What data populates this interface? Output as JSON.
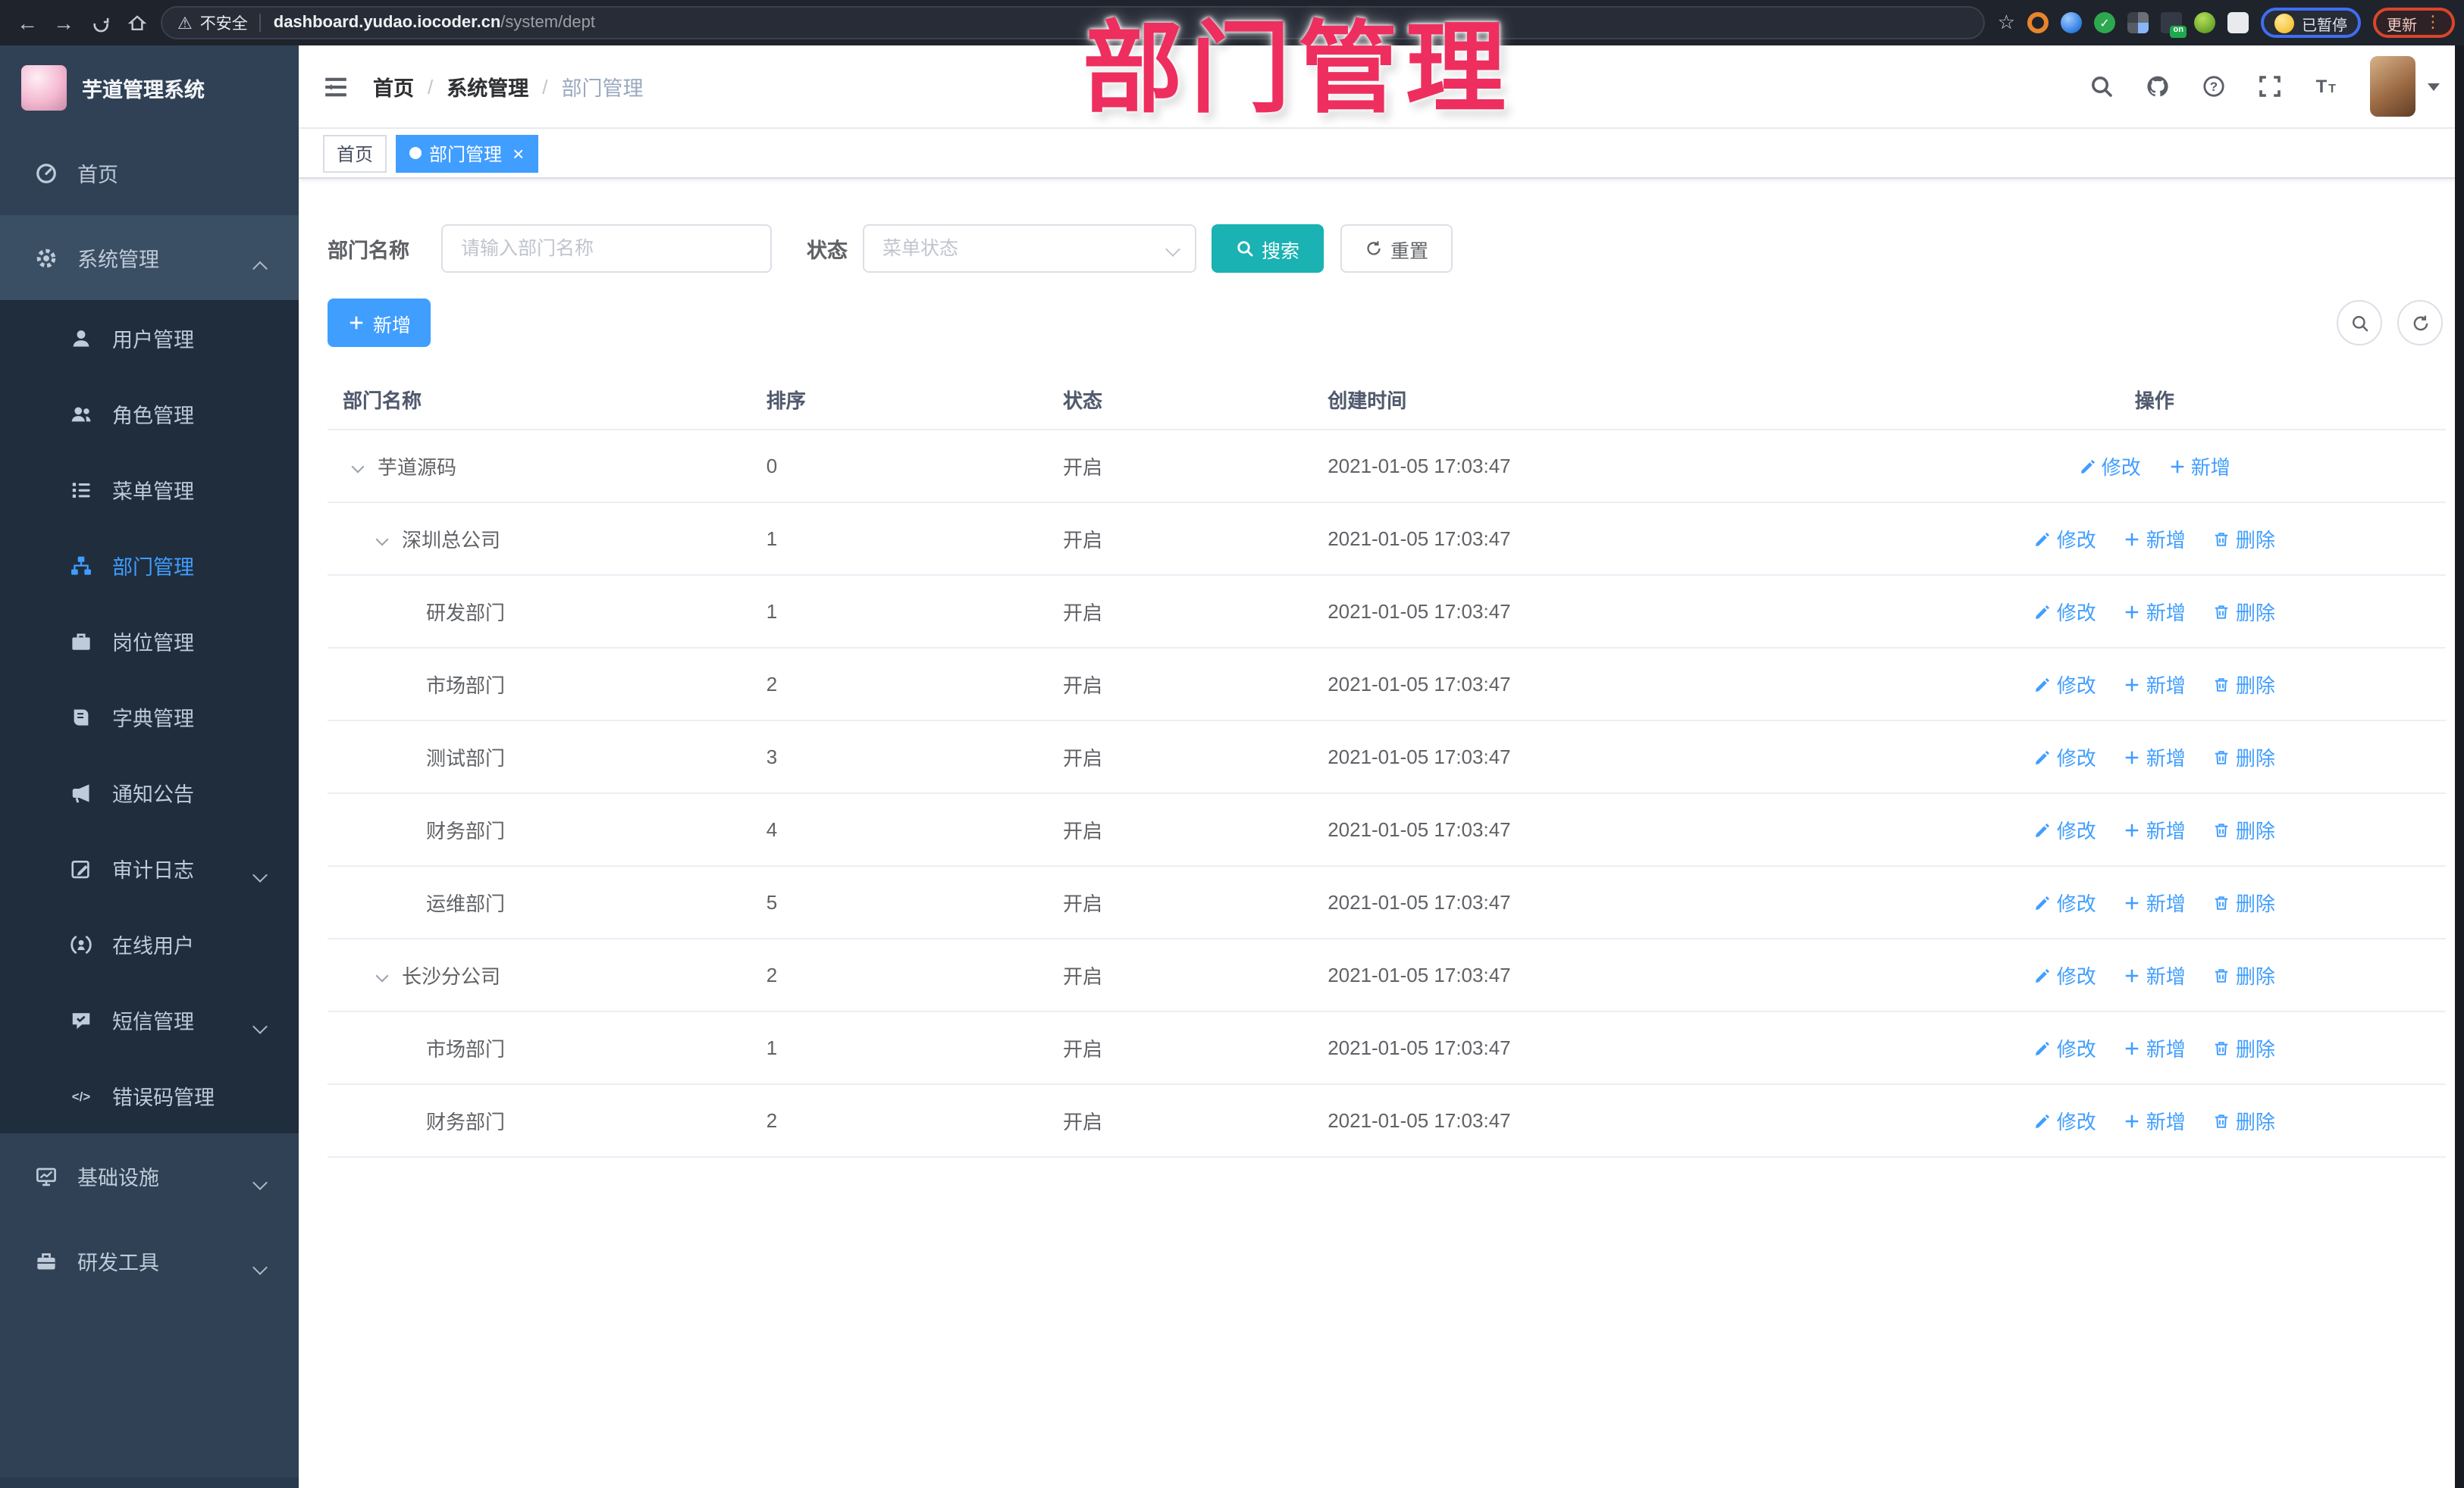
{
  "overlay_title": "部门管理",
  "browser": {
    "security_label": "不安全",
    "url_host": "dashboard.yudao.iocoder.cn",
    "url_path": "/system/dept",
    "paused_label": "已暂停",
    "update_label": "更新"
  },
  "app": {
    "title": "芋道管理系统"
  },
  "sidebar": {
    "items": [
      {
        "label": "首页",
        "icon": "dashboard-icon",
        "kind": "top"
      },
      {
        "label": "系统管理",
        "icon": "gear-icon",
        "kind": "top",
        "state": "open",
        "arrow": "up"
      },
      {
        "label": "用户管理",
        "icon": "user-icon",
        "kind": "sub"
      },
      {
        "label": "角色管理",
        "icon": "users-icon",
        "kind": "sub"
      },
      {
        "label": "菜单管理",
        "icon": "menu-list-icon",
        "kind": "sub"
      },
      {
        "label": "部门管理",
        "icon": "org-tree-icon",
        "kind": "sub",
        "state": "active"
      },
      {
        "label": "岗位管理",
        "icon": "briefcase-icon",
        "kind": "sub"
      },
      {
        "label": "字典管理",
        "icon": "book-icon",
        "kind": "sub"
      },
      {
        "label": "通知公告",
        "icon": "megaphone-icon",
        "kind": "sub"
      },
      {
        "label": "审计日志",
        "icon": "audit-icon",
        "kind": "sub",
        "arrow": "down"
      },
      {
        "label": "在线用户",
        "icon": "online-user-icon",
        "kind": "sub"
      },
      {
        "label": "短信管理",
        "icon": "message-icon",
        "kind": "sub",
        "arrow": "down"
      },
      {
        "label": "错误码管理",
        "icon": "code-icon",
        "kind": "sub"
      },
      {
        "label": "基础设施",
        "icon": "monitor-icon",
        "kind": "top",
        "arrow": "down"
      },
      {
        "label": "研发工具",
        "icon": "toolbox-icon",
        "kind": "top",
        "arrow": "down"
      }
    ]
  },
  "navbar": {
    "breadcrumb": [
      "首页",
      "系统管理",
      "部门管理"
    ]
  },
  "tabs": [
    {
      "label": "首页",
      "active": false
    },
    {
      "label": "部门管理",
      "active": true,
      "closable": true
    }
  ],
  "filters": {
    "dept_label": "部门名称",
    "dept_placeholder": "请输入部门名称",
    "status_label": "状态",
    "status_placeholder": "菜单状态",
    "search_label": "搜索",
    "reset_label": "重置"
  },
  "toolbar": {
    "add_label": "新增"
  },
  "table": {
    "columns": [
      "部门名称",
      "排序",
      "状态",
      "创建时间",
      "操作"
    ],
    "action_labels": {
      "edit": "修改",
      "add": "新增",
      "delete": "删除"
    },
    "rows": [
      {
        "name": "芋道源码",
        "level": 0,
        "expand": true,
        "sort": "0",
        "status": "开启",
        "created": "2021-01-05 17:03:47",
        "actions": [
          "edit",
          "add"
        ]
      },
      {
        "name": "深圳总公司",
        "level": 1,
        "expand": true,
        "sort": "1",
        "status": "开启",
        "created": "2021-01-05 17:03:47",
        "actions": [
          "edit",
          "add",
          "delete"
        ]
      },
      {
        "name": "研发部门",
        "level": 2,
        "expand": false,
        "sort": "1",
        "status": "开启",
        "created": "2021-01-05 17:03:47",
        "actions": [
          "edit",
          "add",
          "delete"
        ]
      },
      {
        "name": "市场部门",
        "level": 2,
        "expand": false,
        "sort": "2",
        "status": "开启",
        "created": "2021-01-05 17:03:47",
        "actions": [
          "edit",
          "add",
          "delete"
        ]
      },
      {
        "name": "测试部门",
        "level": 2,
        "expand": false,
        "sort": "3",
        "status": "开启",
        "created": "2021-01-05 17:03:47",
        "actions": [
          "edit",
          "add",
          "delete"
        ]
      },
      {
        "name": "财务部门",
        "level": 2,
        "expand": false,
        "sort": "4",
        "status": "开启",
        "created": "2021-01-05 17:03:47",
        "actions": [
          "edit",
          "add",
          "delete"
        ]
      },
      {
        "name": "运维部门",
        "level": 2,
        "expand": false,
        "sort": "5",
        "status": "开启",
        "created": "2021-01-05 17:03:47",
        "actions": [
          "edit",
          "add",
          "delete"
        ]
      },
      {
        "name": "长沙分公司",
        "level": 1,
        "expand": true,
        "sort": "2",
        "status": "开启",
        "created": "2021-01-05 17:03:47",
        "actions": [
          "edit",
          "add",
          "delete"
        ]
      },
      {
        "name": "市场部门",
        "level": 2,
        "expand": false,
        "sort": "1",
        "status": "开启",
        "created": "2021-01-05 17:03:47",
        "actions": [
          "edit",
          "add",
          "delete"
        ]
      },
      {
        "name": "财务部门",
        "level": 2,
        "expand": false,
        "sort": "2",
        "status": "开启",
        "created": "2021-01-05 17:03:47",
        "actions": [
          "edit",
          "add",
          "delete"
        ]
      }
    ]
  },
  "colors": {
    "accent_blue": "#409eff",
    "search_teal": "#1ab2b2",
    "overlay_pink": "#ee2e5e",
    "sidebar_bg": "#304156",
    "submenu_bg": "#1f2d3d"
  }
}
